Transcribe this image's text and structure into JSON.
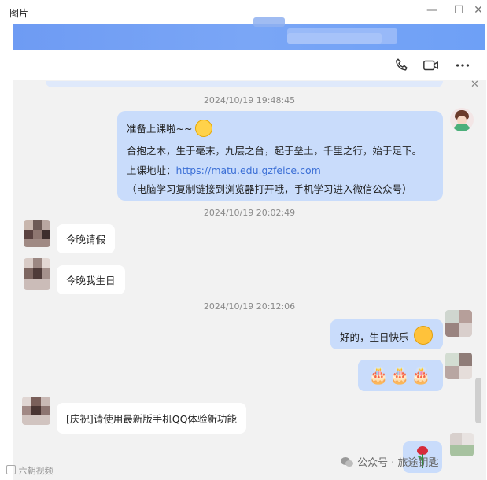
{
  "window": {
    "title": "图片",
    "minimize": "—",
    "maximize": "☐",
    "close": "✕"
  },
  "chat_close": "✕",
  "timestamps": [
    "2024/10/19 19:48:45",
    "2024/10/19 20:02:49",
    "2024/10/19 20:12:06"
  ],
  "messages": {
    "teacher": {
      "line1": "准备上课啦~~",
      "line2": "合抱之木，生于毫末，九层之台，起于垒土，千里之行，始于足下。",
      "line3_label": "上课地址：",
      "line3_link": "https://matu.edu.gzfeice.com",
      "line4": "（电脑学习复制链接到浏览器打开哦，手机学习进入微信公众号）"
    },
    "left1": "今晚请假",
    "left2": "今晚我生日",
    "right1": "好的，生日快乐",
    "cakes": "🎂🎂🎂",
    "left3": "[庆祝]请使用最新版手机QQ体验新功能"
  },
  "watermark": {
    "footer": "公众号 · 旅途钥匙",
    "corner": "六朝视频"
  },
  "colors": {
    "banner": "#6e9bf3",
    "bubble_right": "#c9dcfb",
    "link": "#3b6fd6"
  }
}
